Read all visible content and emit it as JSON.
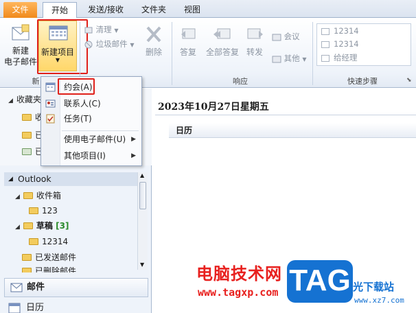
{
  "ribbon_tabs": {
    "file": "文件",
    "home": "开始",
    "send_receive": "发送/接收",
    "folder": "文件夹",
    "view": "视图"
  },
  "ribbon": {
    "new_email_line1": "新建",
    "new_email_line2": "电子邮件",
    "new_items": "新建项目",
    "group_new": "新",
    "clean_up": "清理",
    "junk": "垃圾邮件",
    "delete": "删除",
    "reply": "答复",
    "reply_all": "全部答复",
    "forward": "转发",
    "meeting": "会议",
    "more": "其他",
    "group_respond": "响应",
    "quick_steps": [
      "12314",
      "12314",
      "给经理"
    ],
    "group_quick_steps": "快速步骤"
  },
  "dropdown": {
    "items": [
      {
        "label": "约会(A)"
      },
      {
        "label": "联系人(C)"
      },
      {
        "label": "任务(T)"
      },
      {
        "label": "使用电子邮件(U)"
      },
      {
        "label": "其他项目(I)"
      }
    ]
  },
  "nav": {
    "favorites": "收藏夹",
    "fav_rows": [
      "收",
      "已",
      "已"
    ],
    "outlook": "Outlook",
    "tree": {
      "inbox": "收件箱",
      "inbox_sub": "123",
      "drafts": "草稿",
      "drafts_count": "[3]",
      "drafts_sub": "12314",
      "sent": "已发送邮件",
      "deleted": "已删除邮件"
    },
    "mail_btn": "邮件",
    "cal_btn": "日历"
  },
  "main": {
    "date": "2023年10月27日星期五",
    "calendar_label": "日历"
  },
  "watermark": {
    "cn": "电脑技术网",
    "url": "www.tagxp.com",
    "tag": "TAG",
    "site": "光下载站",
    "site_url": "www.xz7.com"
  },
  "colors": {
    "file_tab": "#f08a1c",
    "highlight": "#ffd76a",
    "annotation": "#e0201a",
    "watermark_red": "#e8201e",
    "watermark_blue": "#1572d2"
  }
}
